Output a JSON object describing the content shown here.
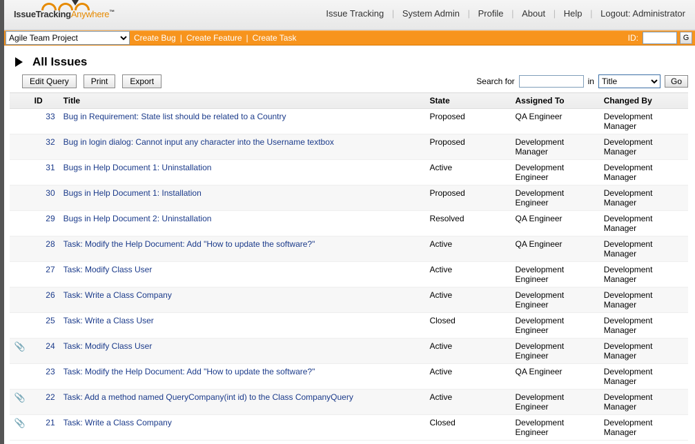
{
  "topnav": {
    "issue_tracking": "Issue Tracking",
    "system_admin": "System Admin",
    "profile": "Profile",
    "about": "About",
    "help": "Help",
    "logout": "Logout: Administrator"
  },
  "logo": {
    "part1": "IssueTracking",
    "part2": "Anywhere",
    "tm": "™"
  },
  "orangebar": {
    "project_selected": "Agile Team Project",
    "create_bug": "Create Bug",
    "create_feature": "Create Feature",
    "create_task": "Create Task",
    "id_label": "ID:",
    "go": "G"
  },
  "page": {
    "title": "All Issues",
    "edit_query": "Edit Query",
    "print": "Print",
    "export": "Export",
    "search_for": "Search for",
    "in": "in",
    "search_field_selected": "Title",
    "go": "Go"
  },
  "columns": {
    "id": "ID",
    "title": "Title",
    "state": "State",
    "assigned": "Assigned To",
    "changed": "Changed By"
  },
  "rows": [
    {
      "attach": false,
      "id": "33",
      "title": "Bug in Requirement: State list should be related to a Country",
      "state": "Proposed",
      "assigned": "QA Engineer",
      "changed": "Development Manager"
    },
    {
      "attach": false,
      "id": "32",
      "title": "Bug in login dialog: Cannot input any character into the Username textbox",
      "state": "Proposed",
      "assigned": "Development Manager",
      "changed": "Development Manager"
    },
    {
      "attach": false,
      "id": "31",
      "title": "Bugs in Help Document 1: Uninstallation",
      "state": "Active",
      "assigned": "Development Engineer",
      "changed": "Development Manager"
    },
    {
      "attach": false,
      "id": "30",
      "title": "Bugs in Help Document 1: Installation",
      "state": "Proposed",
      "assigned": "Development Engineer",
      "changed": "Development Manager"
    },
    {
      "attach": false,
      "id": "29",
      "title": "Bugs in Help Document 2: Uninstallation",
      "state": "Resolved",
      "assigned": "QA Engineer",
      "changed": "Development Manager"
    },
    {
      "attach": false,
      "id": "28",
      "title": "Task: Modify the Help Document: Add \"How to update the software?\"",
      "state": "Active",
      "assigned": "QA Engineer",
      "changed": "Development Manager"
    },
    {
      "attach": false,
      "id": "27",
      "title": "Task: Modify Class User",
      "state": "Active",
      "assigned": "Development Engineer",
      "changed": "Development Manager"
    },
    {
      "attach": false,
      "id": "26",
      "title": "Task: Write a Class Company",
      "state": "Active",
      "assigned": "Development Engineer",
      "changed": "Development Manager"
    },
    {
      "attach": false,
      "id": "25",
      "title": "Task: Write a Class User",
      "state": "Closed",
      "assigned": "Development Engineer",
      "changed": "Development Manager"
    },
    {
      "attach": true,
      "id": "24",
      "title": "Task: Modify Class User",
      "state": "Active",
      "assigned": "Development Engineer",
      "changed": "Development Manager"
    },
    {
      "attach": false,
      "id": "23",
      "title": "Task: Modify the Help Document: Add \"How to update the software?\"",
      "state": "Active",
      "assigned": "QA Engineer",
      "changed": "Development Manager"
    },
    {
      "attach": true,
      "id": "22",
      "title": "Task: Add a method named QueryCompany(int id) to the Class CompanyQuery",
      "state": "Active",
      "assigned": "Development Engineer",
      "changed": "Development Manager"
    },
    {
      "attach": true,
      "id": "21",
      "title": "Task: Write a Class Company",
      "state": "Closed",
      "assigned": "Development Engineer",
      "changed": "Development Manager"
    }
  ]
}
